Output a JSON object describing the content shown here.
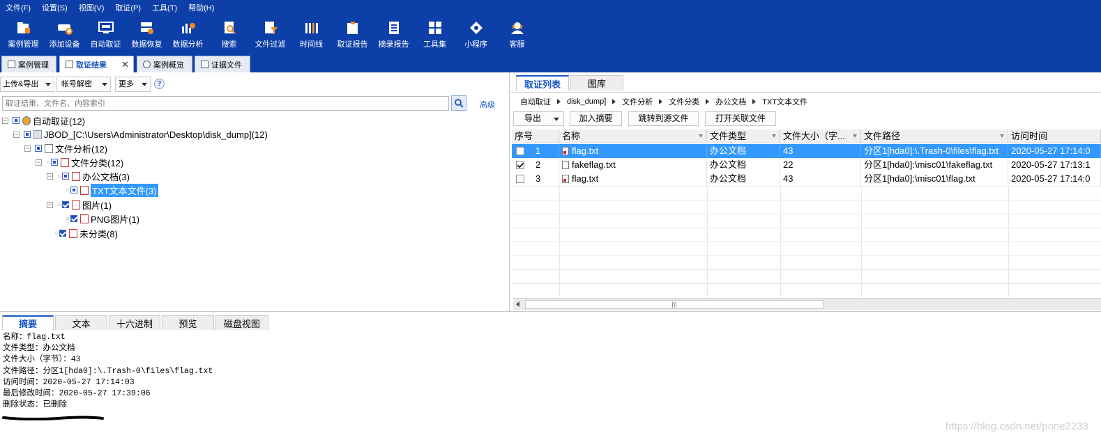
{
  "menu": [
    "文件(F)",
    "设置(S)",
    "视图(V)",
    "取证(P)",
    "工具(T)",
    "帮助(H)"
  ],
  "toolbar": [
    {
      "label": "案例管理",
      "icon": "case-manage-icon"
    },
    {
      "label": "添加设备",
      "icon": "add-device-icon"
    },
    {
      "label": "自动取证",
      "icon": "auto-forensics-icon"
    },
    {
      "label": "数据恢复",
      "icon": "data-recovery-icon"
    },
    {
      "label": "数据分析",
      "icon": "data-analysis-icon"
    },
    {
      "label": "搜索",
      "icon": "search-icon"
    },
    {
      "label": "文件过滤",
      "icon": "file-filter-icon"
    },
    {
      "label": "时间线",
      "icon": "timeline-icon"
    },
    {
      "label": "取证报告",
      "icon": "forensics-report-icon"
    },
    {
      "label": "摘录报告",
      "icon": "excerpt-report-icon"
    },
    {
      "label": "工具集",
      "icon": "toolset-icon"
    },
    {
      "label": "小程序",
      "icon": "mini-program-icon"
    },
    {
      "label": "客服",
      "icon": "customer-service-icon"
    }
  ],
  "main_tabs": [
    {
      "label": "案例管理"
    },
    {
      "label": "取证结果",
      "close": "✕"
    },
    {
      "label": "案例概览"
    },
    {
      "label": "证据文件"
    }
  ],
  "left": {
    "buttons": {
      "upload_export": "上传&导出",
      "account_decrypt": "帐号解密",
      "more": "更多",
      "help": "?"
    },
    "search_placeholder": "取证结果、文件名、内容索引",
    "advanced": "高级",
    "tree": [
      {
        "label": "自动取证(12)"
      },
      {
        "label": "JBOD_[C:\\Users\\Administrator\\Desktop\\disk_dump](12)"
      },
      {
        "label": "文件分析(12)"
      },
      {
        "label": "文件分类(12)"
      },
      {
        "label": "办公文档(3)"
      },
      {
        "label": "TXT文本文件(3)"
      },
      {
        "label": "图片(1)"
      },
      {
        "label": "PNG图片(1)"
      },
      {
        "label": "未分类(8)"
      }
    ]
  },
  "right": {
    "tabs": [
      "取证列表",
      "图库"
    ],
    "breadcrumb": [
      "自动取证",
      "disk_dump]",
      "文件分析",
      "文件分类",
      "办公文档",
      "TXT文本文件"
    ],
    "buttons": {
      "export": "导出",
      "add_summary": "加入摘要",
      "jump_source": "跳转到源文件",
      "open_related": "打开关联文件"
    },
    "columns": [
      "序号",
      "名称",
      "文件类型",
      "文件大小（字...",
      "文件路径",
      "访问时间"
    ],
    "rows": [
      {
        "idx": "1",
        "name": "flag.txt",
        "type": "办公文档",
        "size": "43",
        "path": "分区1[hda0]:\\.Trash-0\\files\\flag.txt",
        "atime": "2020-05-27 17:14:0"
      },
      {
        "idx": "2",
        "name": "fakeflag.txt",
        "type": "办公文档",
        "size": "22",
        "path": "分区1[hda0]:\\misc01\\fakeflag.txt",
        "atime": "2020-05-27 17:13:1"
      },
      {
        "idx": "3",
        "name": "flag.txt",
        "type": "办公文档",
        "size": "43",
        "path": "分区1[hda0]:\\misc01\\flag.txt",
        "atime": "2020-05-27 17:14:0"
      }
    ],
    "scroll_grip": "|||"
  },
  "bottom": {
    "tabs": [
      "摘要",
      "文本",
      "十六进制",
      "预览",
      "磁盘视图"
    ],
    "summary": [
      "名称：flag.txt",
      "文件类型：办公文档",
      "文件大小（字节）：43",
      "文件路径：分区1[hda0]:\\.Trash-0\\files\\flag.txt",
      "访问时间：2020-05-27 17:14:03",
      "最后修改时间：2020-05-27 17:39:06",
      "删除状态：已删除"
    ],
    "watermark": "https://blog.csdn.net/pone2233"
  },
  "colors": {
    "brand_blue": "#0d3fa8",
    "selection": "#3399ff",
    "accent": "#1a57c7"
  }
}
